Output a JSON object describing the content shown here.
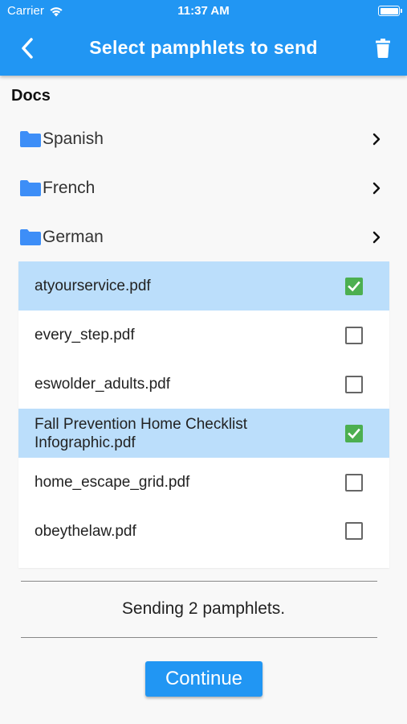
{
  "status_bar": {
    "carrier": "Carrier",
    "time": "11:37 AM"
  },
  "header": {
    "title": "Select pamphlets to send"
  },
  "section": {
    "title": "Docs"
  },
  "folders": [
    {
      "label": "Spanish"
    },
    {
      "label": "French"
    },
    {
      "label": "German"
    }
  ],
  "files": [
    {
      "name": "atyourservice.pdf",
      "selected": true
    },
    {
      "name": "every_step.pdf",
      "selected": false
    },
    {
      "name": "eswolder_adults.pdf",
      "selected": false
    },
    {
      "name": "Fall Prevention Home Checklist Infographic.pdf",
      "selected": true
    },
    {
      "name": "home_escape_grid.pdf",
      "selected": false
    },
    {
      "name": "obeythelaw.pdf",
      "selected": false
    }
  ],
  "summary": {
    "text": "Sending 2 pamphlets."
  },
  "actions": {
    "continue_label": "Continue"
  },
  "colors": {
    "accent": "#2196f3",
    "selected_row": "#bbdefb",
    "checked": "#4caf50",
    "folder": "#3d8ef7"
  },
  "icons": {
    "back": "chevron-left-icon",
    "trash": "trash-icon",
    "folder": "folder-icon",
    "chevron": "chevron-right-icon",
    "wifi": "wifi-icon"
  }
}
